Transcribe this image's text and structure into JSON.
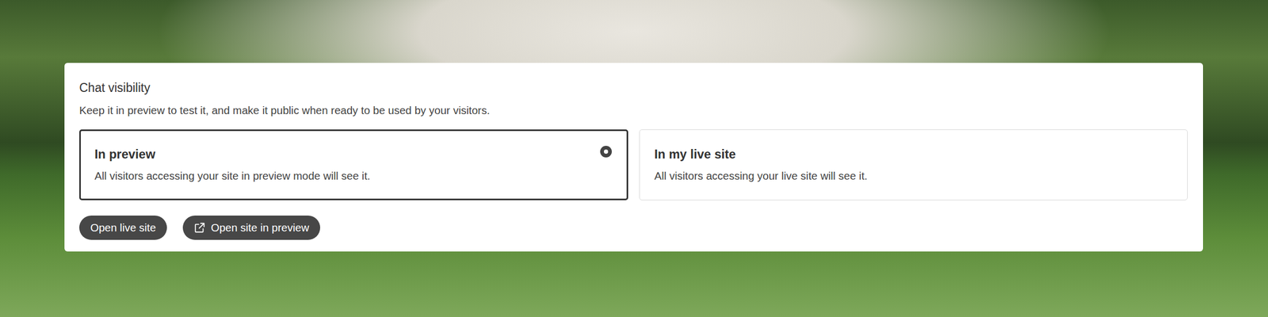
{
  "panel": {
    "title": "Chat visibility",
    "description": "Keep it in preview to test it, and make it public when ready to be used by your visitors."
  },
  "options": [
    {
      "title": "In preview",
      "description": "All visitors accessing your site in preview mode will see it.",
      "selected": true
    },
    {
      "title": "In my live site",
      "description": "All visitors accessing your live site will see it.",
      "selected": false
    }
  ],
  "buttons": [
    {
      "label": "Open live site",
      "kind": "plain"
    },
    {
      "label": "Open site in preview",
      "kind": "with-icon"
    }
  ]
}
